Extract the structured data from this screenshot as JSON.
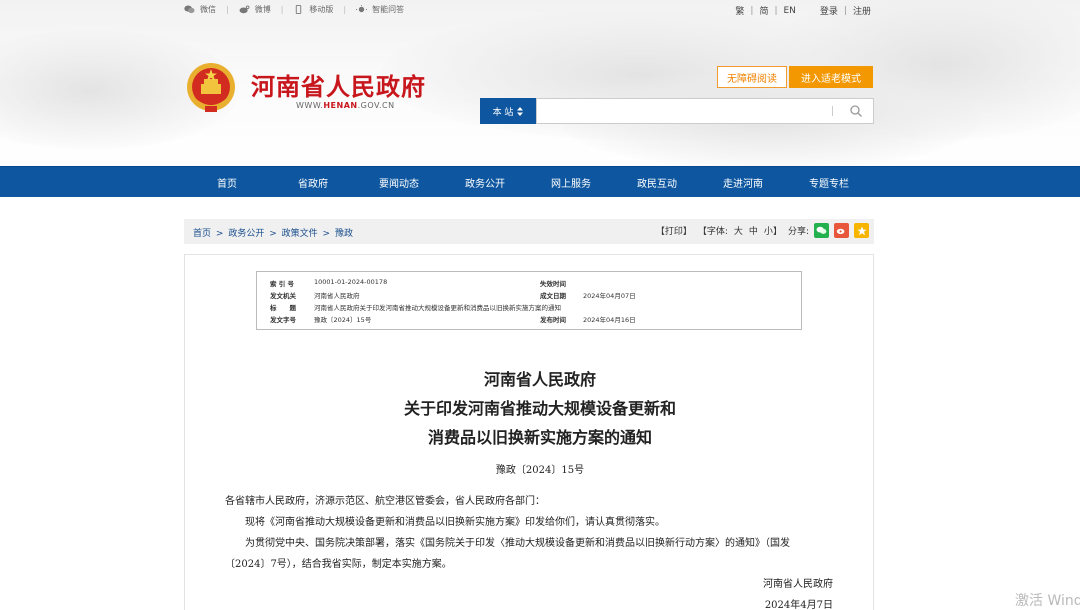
{
  "topbar": {
    "links": [
      {
        "label": "微信",
        "icon": "wechat-icon"
      },
      {
        "label": "微博",
        "icon": "weibo-icon"
      },
      {
        "label": "移动版",
        "icon": "mobile-icon"
      },
      {
        "label": "智能问答",
        "icon": "smart-qa-icon"
      }
    ],
    "lang": [
      "繁",
      "简",
      "EN"
    ],
    "login": "登录",
    "register": "注册"
  },
  "site": {
    "title": "河南省人民政府",
    "domain_prefix": "WWW.",
    "domain_brand": "HENAN",
    "domain_suffix": ".GOV.CN",
    "brand_color": "#c8161d"
  },
  "accessibility": {
    "barrier_free": "无障碍阅读",
    "elder_mode": "进入适老模式"
  },
  "search": {
    "scope": "本 站",
    "placeholder": ""
  },
  "nav": {
    "items": [
      "首页",
      "省政府",
      "要闻动态",
      "政务公开",
      "网上服务",
      "政民互动",
      "走进河南",
      "专题专栏"
    ]
  },
  "breadcrumb": {
    "items": [
      "首页",
      "政务公开",
      "政策文件",
      "豫政"
    ],
    "separator": ">"
  },
  "tools": {
    "print": "【打印】",
    "font_label": "【字体:",
    "font_large": "大",
    "font_medium": "中",
    "font_small": "小",
    "font_end": "】",
    "share": "分享:"
  },
  "meta": {
    "rows": [
      {
        "k": "索 引 号",
        "v": "10001-01-2024-00178",
        "k2": "失效时间",
        "v2": ""
      },
      {
        "k": "发文机关",
        "v": "河南省人民政府",
        "k2": "成文日期",
        "v2": "2024年04月07日"
      },
      {
        "k": "标　　题",
        "v": "河南省人民政府关于印发河南省推动大规模设备更新和消费品以旧换新实施方案的通知",
        "k2": "",
        "v2": ""
      },
      {
        "k": "发文字号",
        "v": "豫政〔2024〕15号",
        "k2": "发布时间",
        "v2": "2024年04月16日"
      }
    ]
  },
  "document": {
    "title_lines": [
      "河南省人民政府",
      "关于印发河南省推动大规模设备更新和",
      "消费品以旧换新实施方案的通知"
    ],
    "number": "豫政〔2024〕15号",
    "recipients": "各省辖市人民政府，济源示范区、航空港区管委会，省人民政府各部门：",
    "para1": "现将《河南省推动大规模设备更新和消费品以旧换新实施方案》印发给你们，请认真贯彻落实。",
    "para2_line1": "为贯彻党中央、国务院决策部署，落实《国务院关于印发〈推动大规模设备更新和消费品以旧换新行动方案〉的通知》（国发",
    "para2_line2": "〔2024〕7号），结合我省实际，制定本实施方案。",
    "signer": "河南省人民政府",
    "date": "2024年4月7日"
  },
  "watermark": "激活 Windows",
  "colors": {
    "nav_blue": "#0e57a0",
    "orange": "#f39800",
    "link_blue": "#1a4e8c"
  }
}
